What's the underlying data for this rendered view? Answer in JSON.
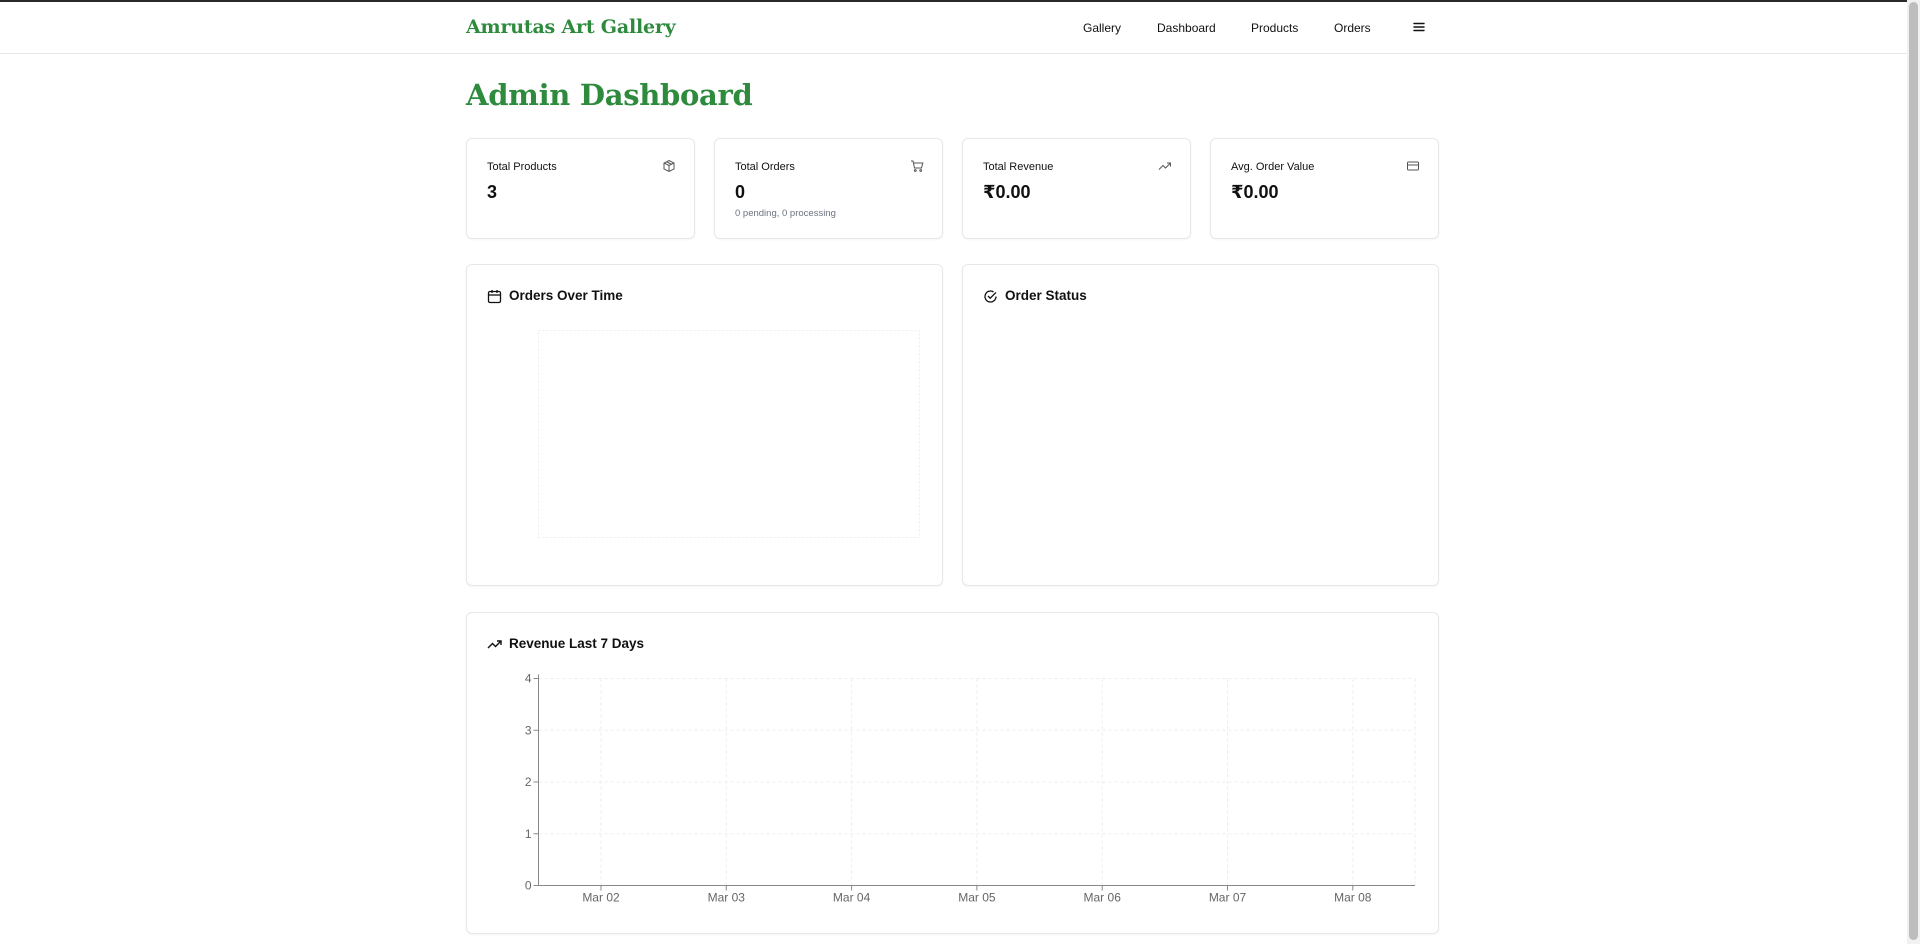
{
  "header": {
    "brand": "Amrutas Art Gallery",
    "nav": [
      "Gallery",
      "Dashboard",
      "Products",
      "Orders"
    ],
    "menu_icon": "hamburger-icon"
  },
  "page": {
    "title": "Admin Dashboard"
  },
  "stats": [
    {
      "label": "Total Products",
      "value": "3",
      "sub": "",
      "icon": "package-icon"
    },
    {
      "label": "Total Orders",
      "value": "0",
      "sub": "0 pending, 0 processing",
      "icon": "cart-icon"
    },
    {
      "label": "Total Revenue",
      "value": "₹0.00",
      "sub": "",
      "icon": "trending-up-icon"
    },
    {
      "label": "Avg. Order Value",
      "value": "₹0.00",
      "sub": "",
      "icon": "credit-card-icon"
    }
  ],
  "panels": {
    "orders_over_time": {
      "title": "Orders Over Time",
      "icon": "calendar-icon"
    },
    "order_status": {
      "title": "Order Status",
      "icon": "check-circle-icon"
    },
    "revenue": {
      "title": "Revenue Last 7 Days",
      "icon": "trending-up-icon"
    }
  },
  "colors": {
    "brand": "#2e8b3e",
    "text": "#111111",
    "muted": "#6b7280",
    "border": "#e5e7eb"
  },
  "chart_data": [
    {
      "type": "line",
      "title": "Revenue Last 7 Days",
      "categories": [
        "Mar 02",
        "Mar 03",
        "Mar 04",
        "Mar 05",
        "Mar 06",
        "Mar 07",
        "Mar 08"
      ],
      "series": [],
      "ylim": [
        0,
        4
      ],
      "yticks": [
        "0",
        "1",
        "2",
        "3",
        "4"
      ],
      "grid": true
    }
  ]
}
